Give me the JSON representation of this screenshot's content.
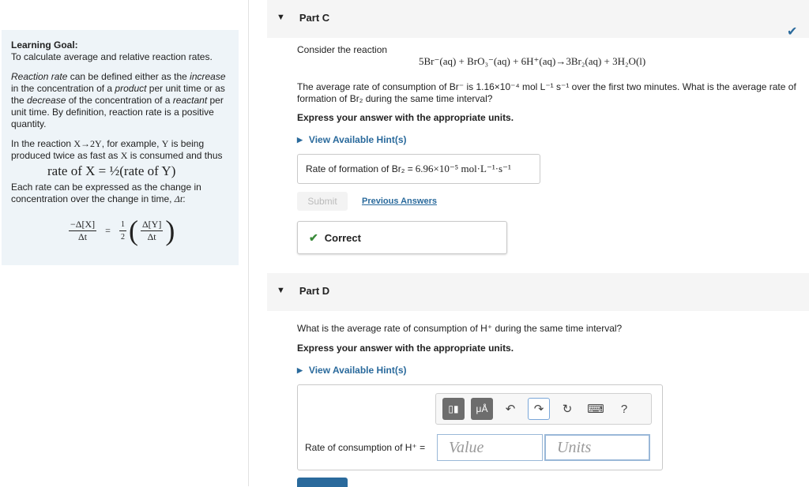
{
  "goal": {
    "title": "Learning Goal:",
    "subtitle": "To calculate average and relative reaction rates.",
    "definition": {
      "t1": "Reaction rate",
      "t2": " can be defined either as the ",
      "t3": "increase",
      "t4": " in the concentration of a ",
      "t5": "product",
      "t6": " per unit time or as the ",
      "t7": "decrease",
      "t8": " of the concentration of a ",
      "t9": "reactant",
      "t10": " per unit time. By definition, reaction rate is a positive quantity."
    },
    "example": {
      "t1": "In the reaction ",
      "reaction": "X→2Y",
      "t2": ", for example, ",
      "y": "Y",
      "t3": " is being produced twice as fast as ",
      "x": "X",
      "t4": " is consumed and thus"
    },
    "rate_equation": "rate of X = ½(rate of Y)",
    "change_text": "Each rate can be expressed as the change in concentration over the change in time, ",
    "delta_t": "Δt",
    "colon": ":",
    "frac": {
      "lhs_num": "−Δ[X]",
      "lhs_den": "Δt",
      "equals": "=",
      "half_num": "1",
      "half_den": "2",
      "rhs_num": "Δ[Y]",
      "rhs_den": "Δt"
    }
  },
  "partC": {
    "title": "Part C",
    "consider": "Consider the reaction",
    "reaction": "5Br⁻(aq) + BrO₃⁻(aq) + 6H⁺(aq)→3Br₂(aq) + 3H₂O(l)",
    "question": "The average rate of consumption of Br⁻ is 1.16×10⁻⁴ mol L⁻¹ s⁻¹ over the first two minutes. What is the average rate of formation of Br₂ during the same time interval?",
    "instruction": "Express your answer with the appropriate units.",
    "hint": "View Available Hint(s)",
    "answer_label": "Rate of formation of Br₂ = ",
    "answer_value": "6.96×10⁻⁵ mol·L⁻¹·s⁻¹",
    "submit": "Submit",
    "previous": "Previous Answers",
    "correct": "Correct",
    "check_icon": "check-icon"
  },
  "partD": {
    "title": "Part D",
    "question": "What is the average rate of consumption of H⁺ during the same time interval?",
    "instruction": "Express your answer with the appropriate units.",
    "hint": "View Available Hint(s)",
    "input_label": "Rate of consumption of H⁺ = ",
    "value_placeholder": "Value",
    "units_placeholder": "Units",
    "toolbar": {
      "templates": "▯▮",
      "units": "μÅ",
      "undo": "↶",
      "redo": "↷",
      "reset": "↻",
      "keyboard": "⌨",
      "help": "?"
    }
  },
  "colors": {
    "accent": "#2a6a9c",
    "success": "#3a8a3a",
    "panel": "#eef4f8"
  }
}
